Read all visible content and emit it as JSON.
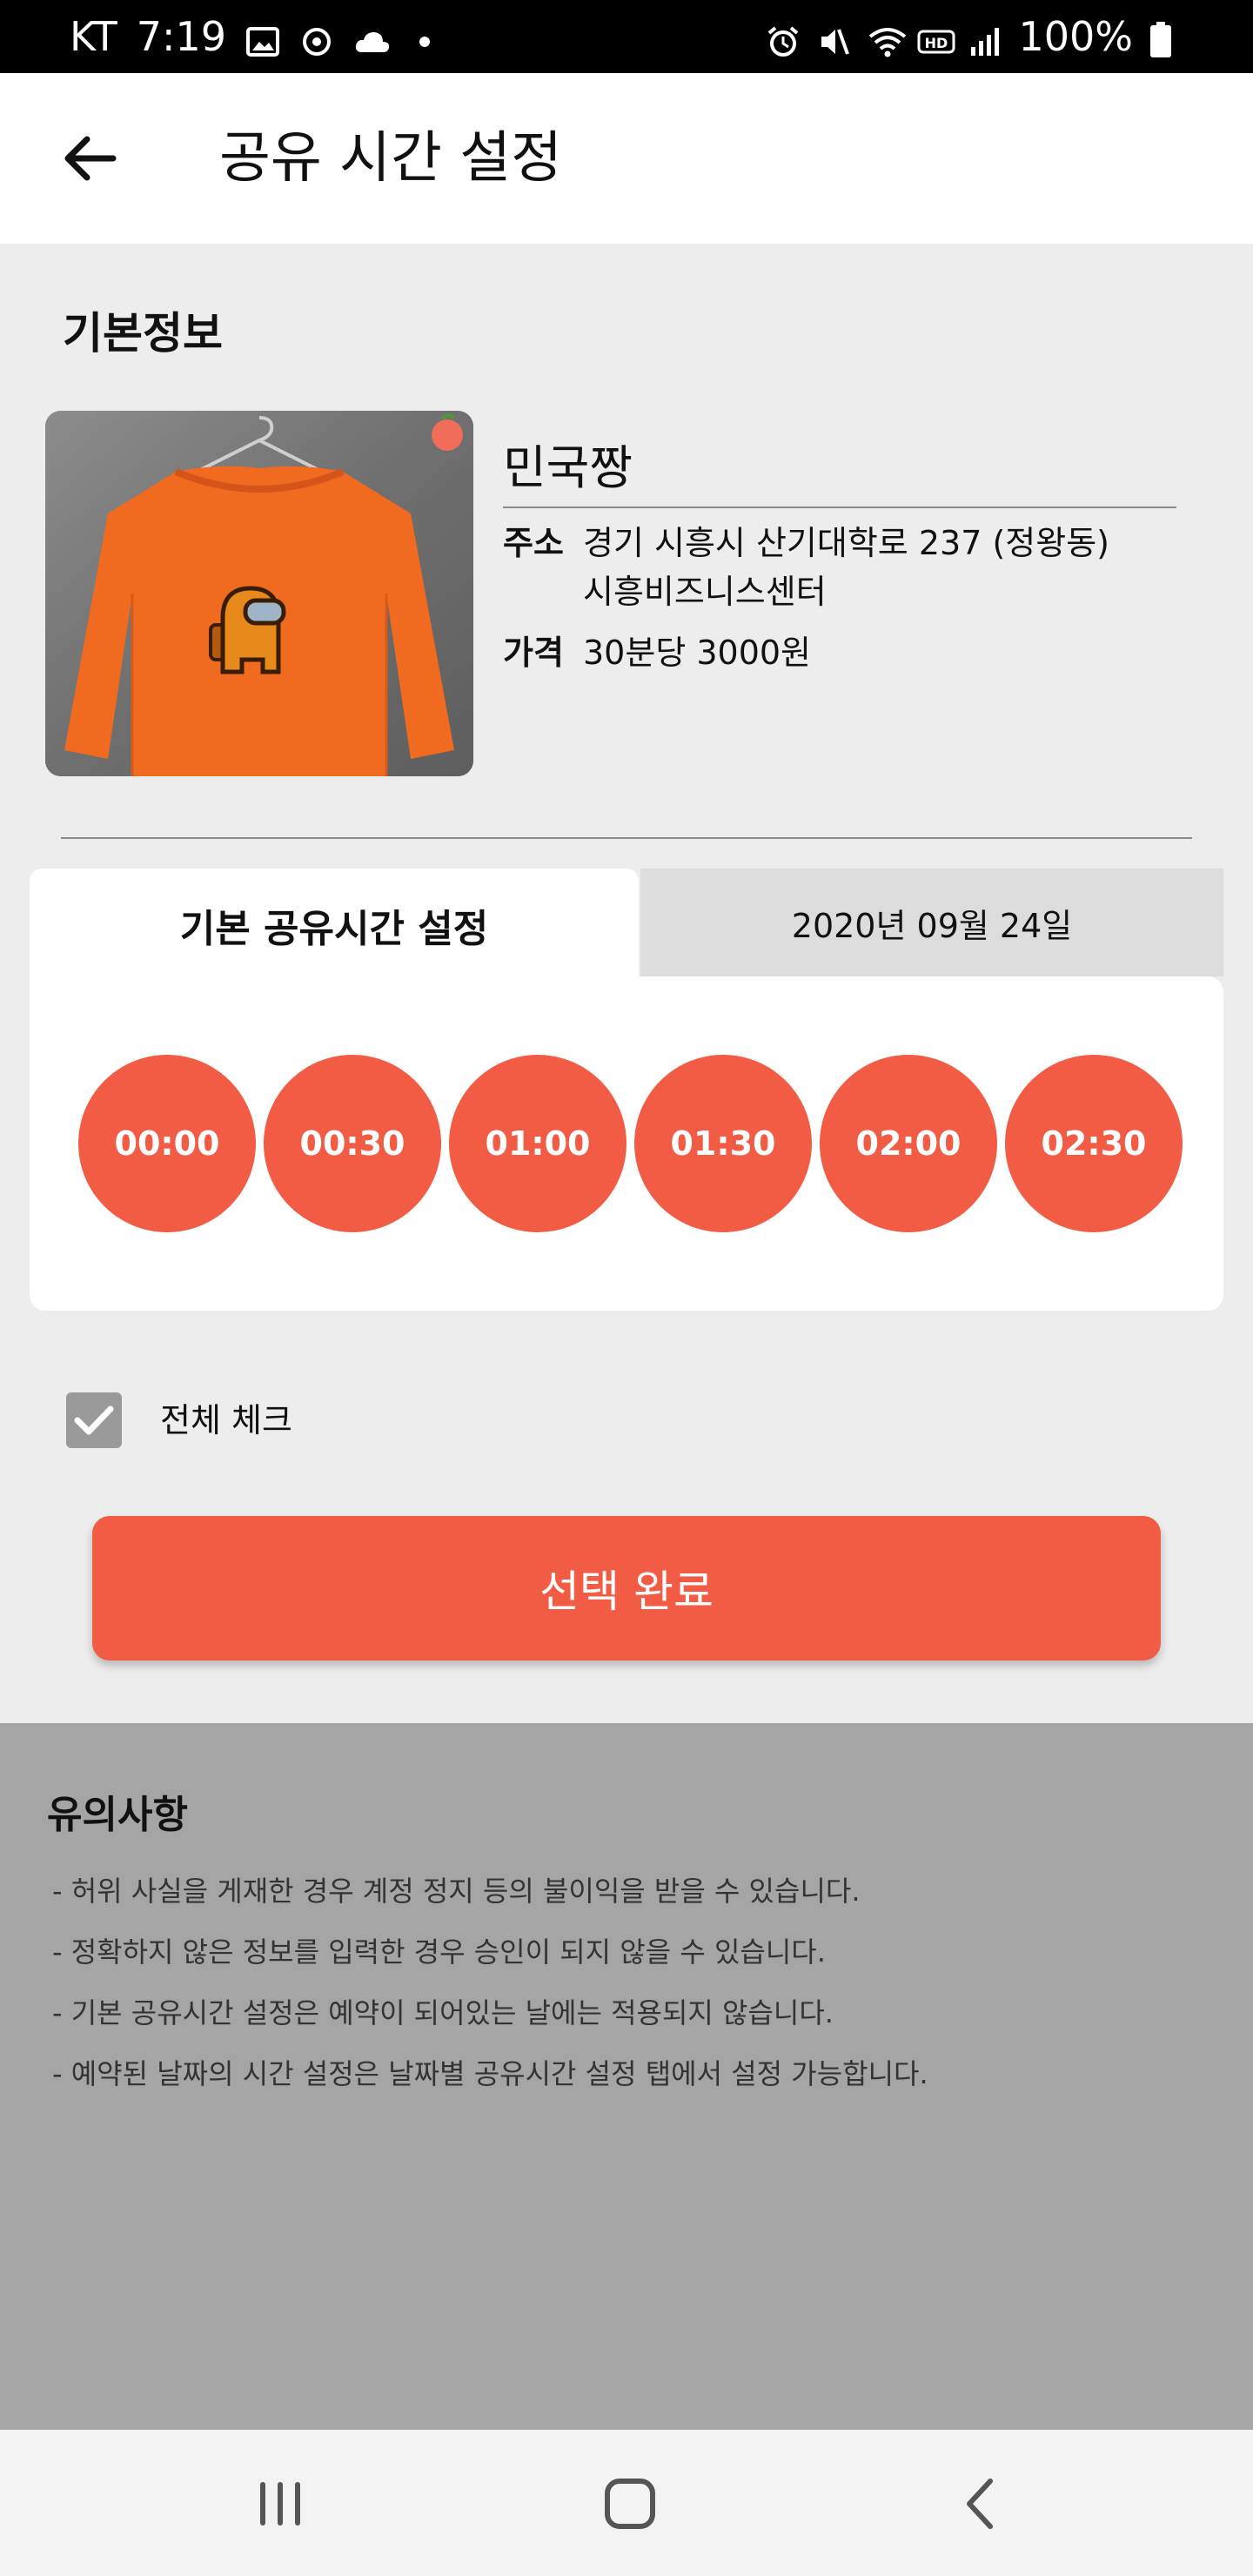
{
  "status_bar": {
    "carrier": "KT",
    "time": "7:19",
    "battery": "100%",
    "icons_left": [
      "image-icon",
      "sync-icon",
      "cloud-icon",
      "dot-icon"
    ],
    "icons_right": [
      "alarm-icon",
      "mute-icon",
      "wifi-icon",
      "hd-icon",
      "signal-icon",
      "battery-icon"
    ]
  },
  "app_bar": {
    "title": "공유 시간 설정",
    "back_icon": "arrow-left-icon"
  },
  "basic_info": {
    "section_title": "기본정보",
    "store_name": "민국짱",
    "address_label": "주소",
    "address_line1": "경기 시흥시 산기대학로 237 (정왕동)",
    "address_line2": "시흥비즈니스센터",
    "price_label": "가격",
    "price_value": "30분당 3000원"
  },
  "tabs": [
    {
      "label": "기본 공유시간 설정",
      "active": true
    },
    {
      "label": "2020년 09월 24일",
      "active": false
    }
  ],
  "time_slots": [
    "00:00",
    "00:30",
    "01:00",
    "01:30",
    "02:00",
    "02:30"
  ],
  "check_all": {
    "label": "전체 체크",
    "checked": true
  },
  "submit_button": {
    "label": "선택 완료"
  },
  "notice": {
    "title": "유의사항",
    "items": [
      "- 허위 사실을 게재한 경우 계정 정지 등의 불이익을 받을 수 있습니다.",
      "- 정확하지 않은 정보를 입력한 경우 승인이 되지 않을 수 있습니다.",
      "- 기본 공유시간 설정은 예약이 되어있는 날에는 적용되지 않습니다.",
      "- 예약된 날짜의 시간 설정은 날짜별 공유시간 설정 탭에서 설정 가능합니다."
    ]
  },
  "nav_bar": {
    "buttons": [
      "recents-icon",
      "home-icon",
      "back-icon"
    ]
  },
  "colors": {
    "accent": "#f25c45",
    "background": "#ededed",
    "notice_bg": "#a5a5a5",
    "tab_inactive": "#dcdcdc"
  }
}
